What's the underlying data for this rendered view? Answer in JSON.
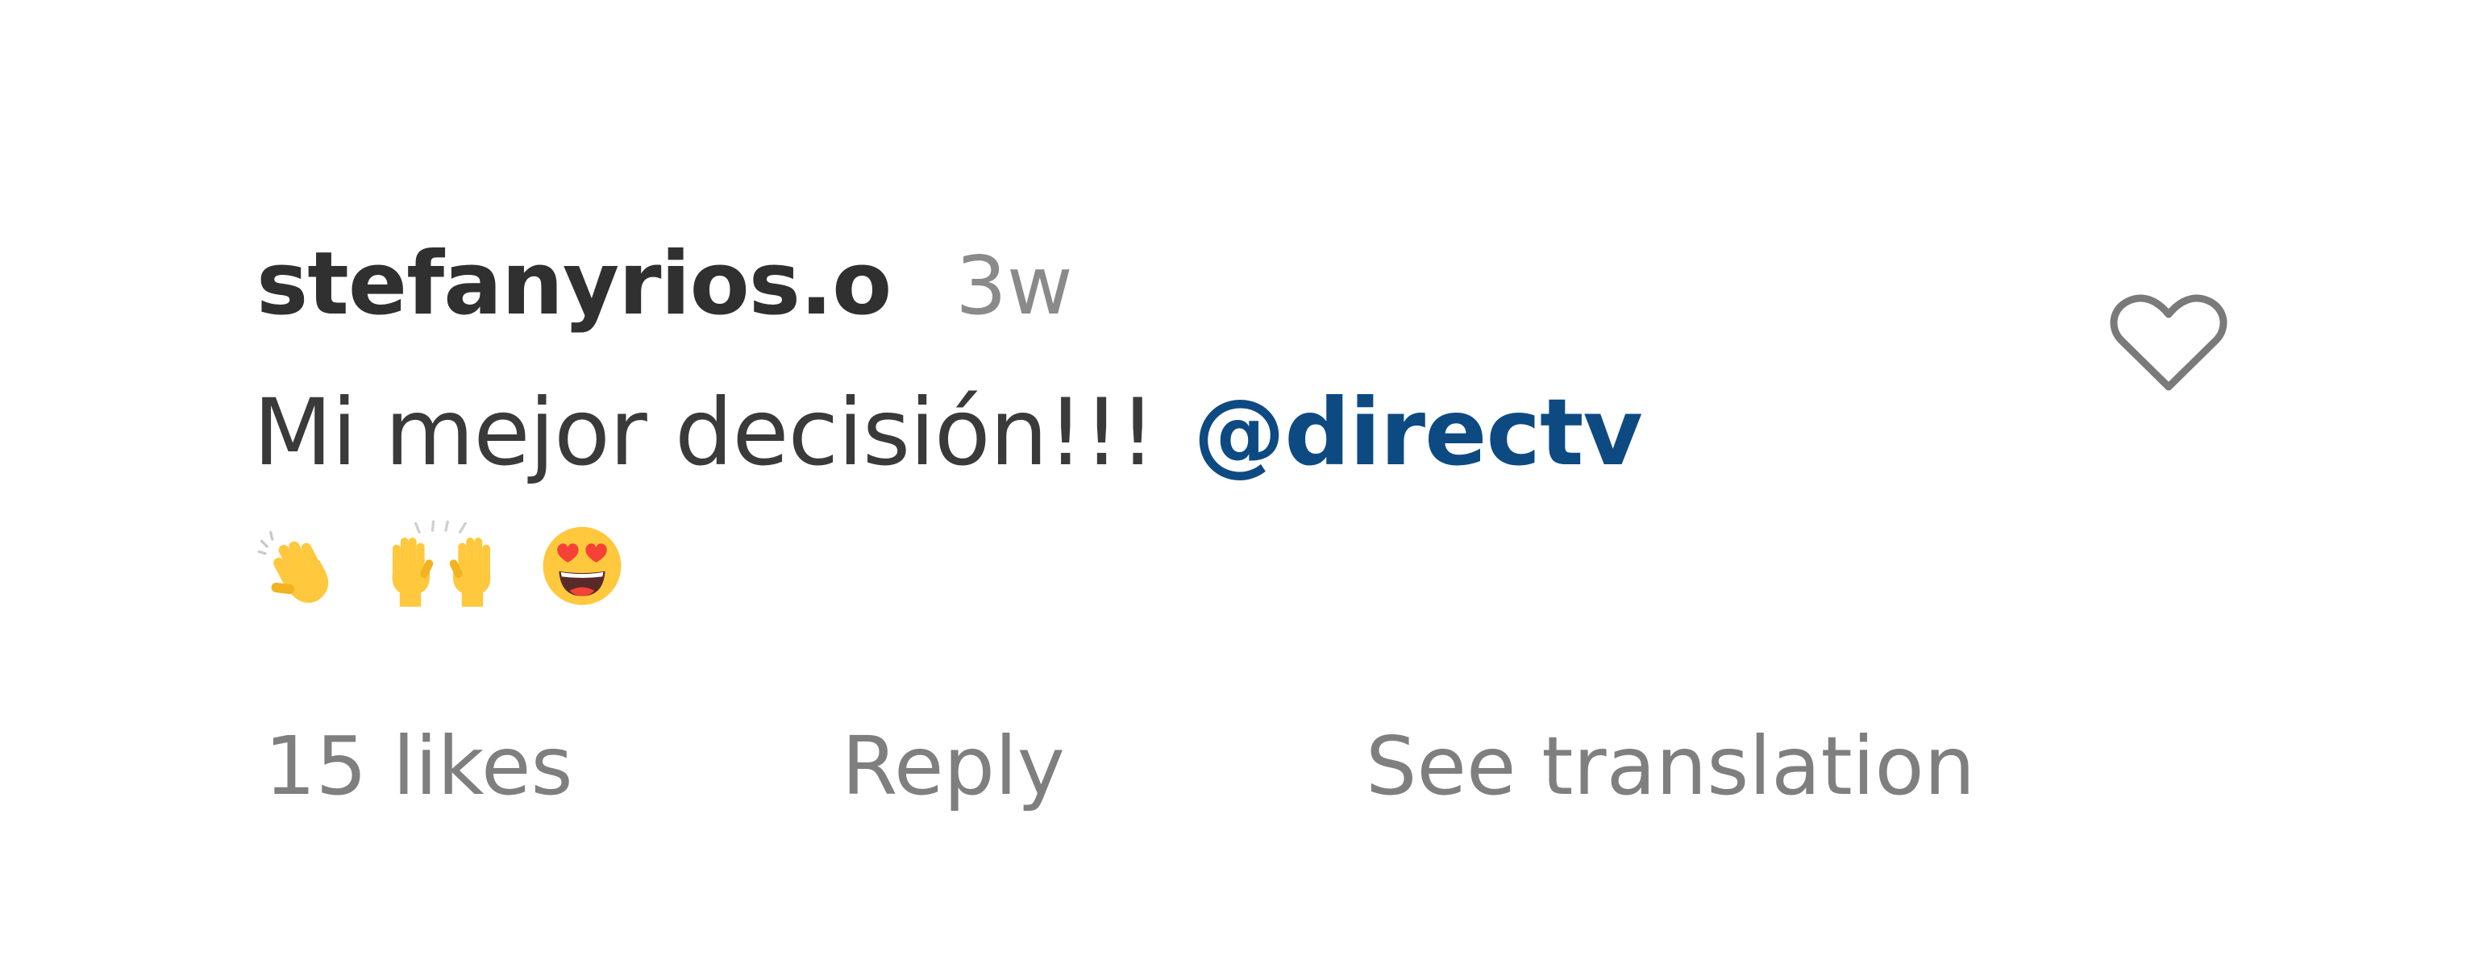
{
  "comment": {
    "username": "stefanyrios.o",
    "timestamp": "3w",
    "text": "Mi mejor decisión!!!",
    "mention": "@directv",
    "emojis": [
      {
        "icon": "waving-hand-icon"
      },
      {
        "icon": "raising-hands-icon"
      },
      {
        "icon": "heart-eyes-face-icon"
      }
    ],
    "likes": "15 likes",
    "reply_label": "Reply",
    "translate_label": "See translation",
    "like_icon": "heart-outline-icon"
  },
  "colors": {
    "username": "#303030",
    "text": "#3a3a3a",
    "meta": "#8a8a8a",
    "mention": "#0d4a82",
    "emoji_yellow": "#FFC83D",
    "heart_red": "#F44336"
  }
}
